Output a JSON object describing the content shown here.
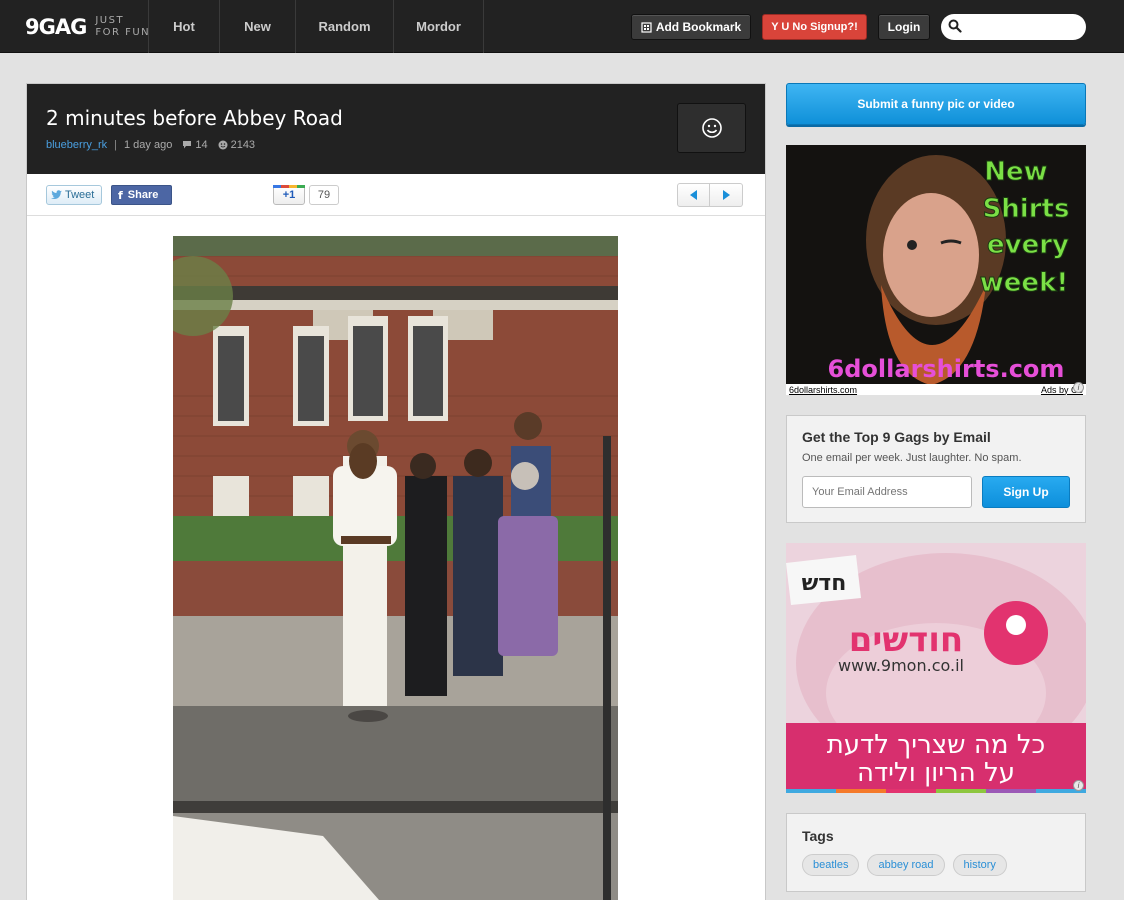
{
  "header": {
    "logo": "9GAG",
    "tagline_1": "JUST",
    "tagline_2": "FOR FUN",
    "nav": [
      {
        "label": "Hot"
      },
      {
        "label": "New"
      },
      {
        "label": "Random"
      },
      {
        "label": "Mordor"
      }
    ],
    "add_bookmark": "Add Bookmark",
    "no_signup": "Y U No Signup?!",
    "login": "Login",
    "search_placeholder": ""
  },
  "post": {
    "title": "2 minutes before Abbey Road",
    "author": "blueberry_rk",
    "separator": "|",
    "age": "1 day ago",
    "comments": "14",
    "votes": "2143",
    "tweet": "Tweet",
    "share": "Share",
    "plusone": "+1",
    "plusone_count": "79",
    "image_description": "Beatles standing on the pavement on Abbey Road with an older woman, before the famous crossing photo",
    "image_icon": "photo-icon"
  },
  "sidebar": {
    "submit": "Submit a funny pic or video",
    "ad1": {
      "headline_1": "New",
      "headline_2": "Shirts",
      "headline_3": "every",
      "headline_4": "week!",
      "brand": "6dollarshirts.com",
      "footer_left": "6dollarshirts.com",
      "footer_right": "Ads by Go"
    },
    "email": {
      "title": "Get the Top 9 Gags by Email",
      "subtitle": "One email per week. Just laughter. No spam.",
      "placeholder": "Your Email Address",
      "button": "Sign Up"
    },
    "ad2": {
      "badge": "חדש",
      "brand": "חודשים",
      "url": "www.9mon.co.il",
      "line_1": "כל מה שצריך לדעת",
      "line_2": "על הריון ולידה"
    },
    "tags_title": "Tags",
    "tags": [
      {
        "label": "beatles"
      },
      {
        "label": "abbey road"
      },
      {
        "label": "history"
      }
    ]
  },
  "colors": {
    "topbar": "#222222",
    "accent_blue": "#0f90d8",
    "signup_red": "#d9443a",
    "link": "#4a9fe0"
  }
}
